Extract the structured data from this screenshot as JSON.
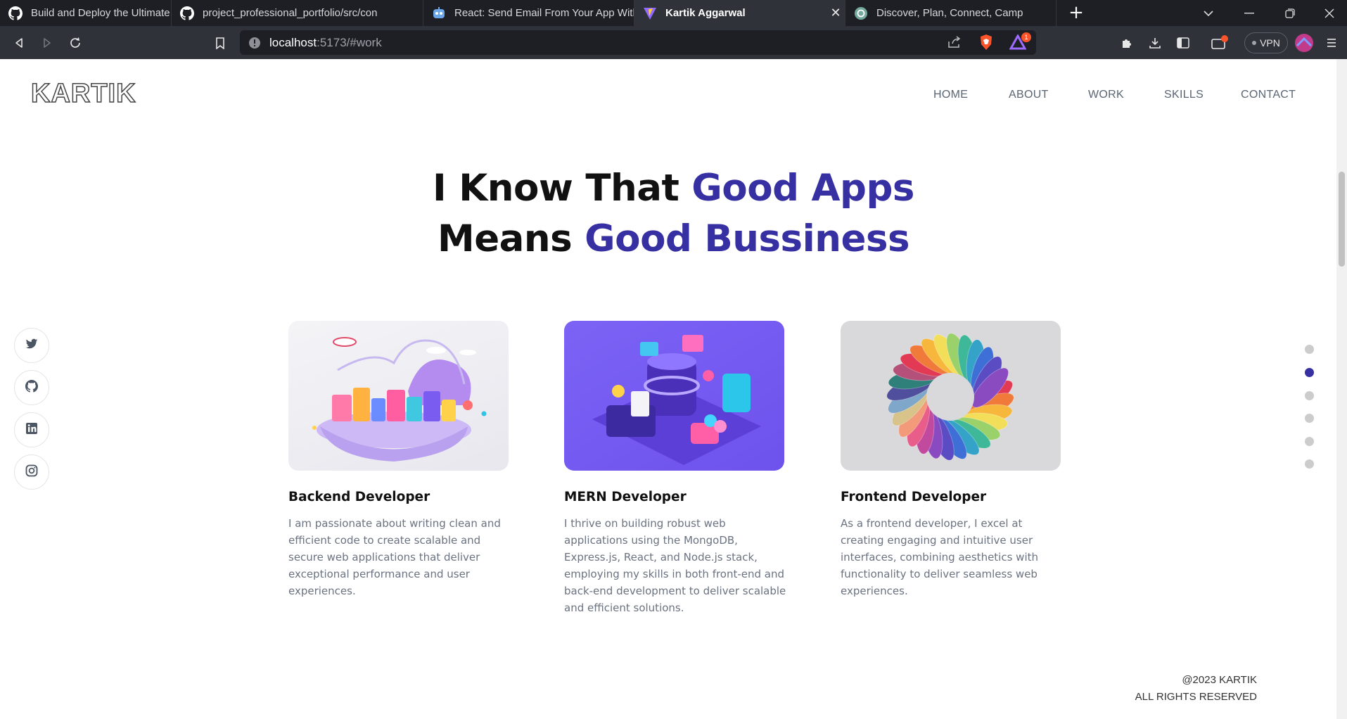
{
  "browser": {
    "tabs": [
      {
        "title": "Build and Deploy the Ultimate Web De",
        "icon": "github-icon"
      },
      {
        "title": "project_professional_portfolio/src/con",
        "icon": "github-icon"
      },
      {
        "title": "React: Send Email From Your App With",
        "icon": "robot-icon"
      },
      {
        "title": "Kartik Aggarwal",
        "icon": "vite-icon",
        "active": true,
        "close": "✕"
      },
      {
        "title": "Discover, Plan, Connect, Camp",
        "icon": "chatgpt-icon"
      }
    ],
    "new_tab": "+",
    "url_host": "localhost",
    "url_rest": ":5173/#work",
    "vpn_label": "VPN",
    "notification_count": "1",
    "accent_color": "#fb542b"
  },
  "site": {
    "logo": "KARTIK",
    "nav": [
      "HOME",
      "ABOUT",
      "WORK",
      "SKILLS",
      "CONTACT"
    ],
    "hero": {
      "line1_plain": "I Know That ",
      "line1_accent": "Good Apps",
      "line2_plain": "Means ",
      "line2_accent": "Good Bussiness"
    },
    "accent_color": "#3730a3",
    "cards": [
      {
        "title": "Backend Developer",
        "description": "I am passionate about writing clean and efficient code to create scalable and secure web applications that deliver exceptional performance and user experiences."
      },
      {
        "title": "MERN Developer",
        "description": "I thrive on building robust web applications using the MongoDB, Express.js, React, and Node.js stack, employing my skills in both front-end and back-end development to deliver scalable and efficient solutions."
      },
      {
        "title": "Frontend Developer",
        "description": "As a frontend developer, I excel at creating engaging and intuitive user interfaces, combining aesthetics with functionality to deliver seamless web experiences."
      }
    ],
    "socials": [
      "twitter-icon",
      "github-icon",
      "linkedin-icon",
      "instagram-icon"
    ],
    "section_dots": {
      "count": 6,
      "active_index": 1
    },
    "footer": {
      "copyright": "@2023 KARTIK",
      "rights": "ALL RIGHTS RESERVED"
    }
  }
}
